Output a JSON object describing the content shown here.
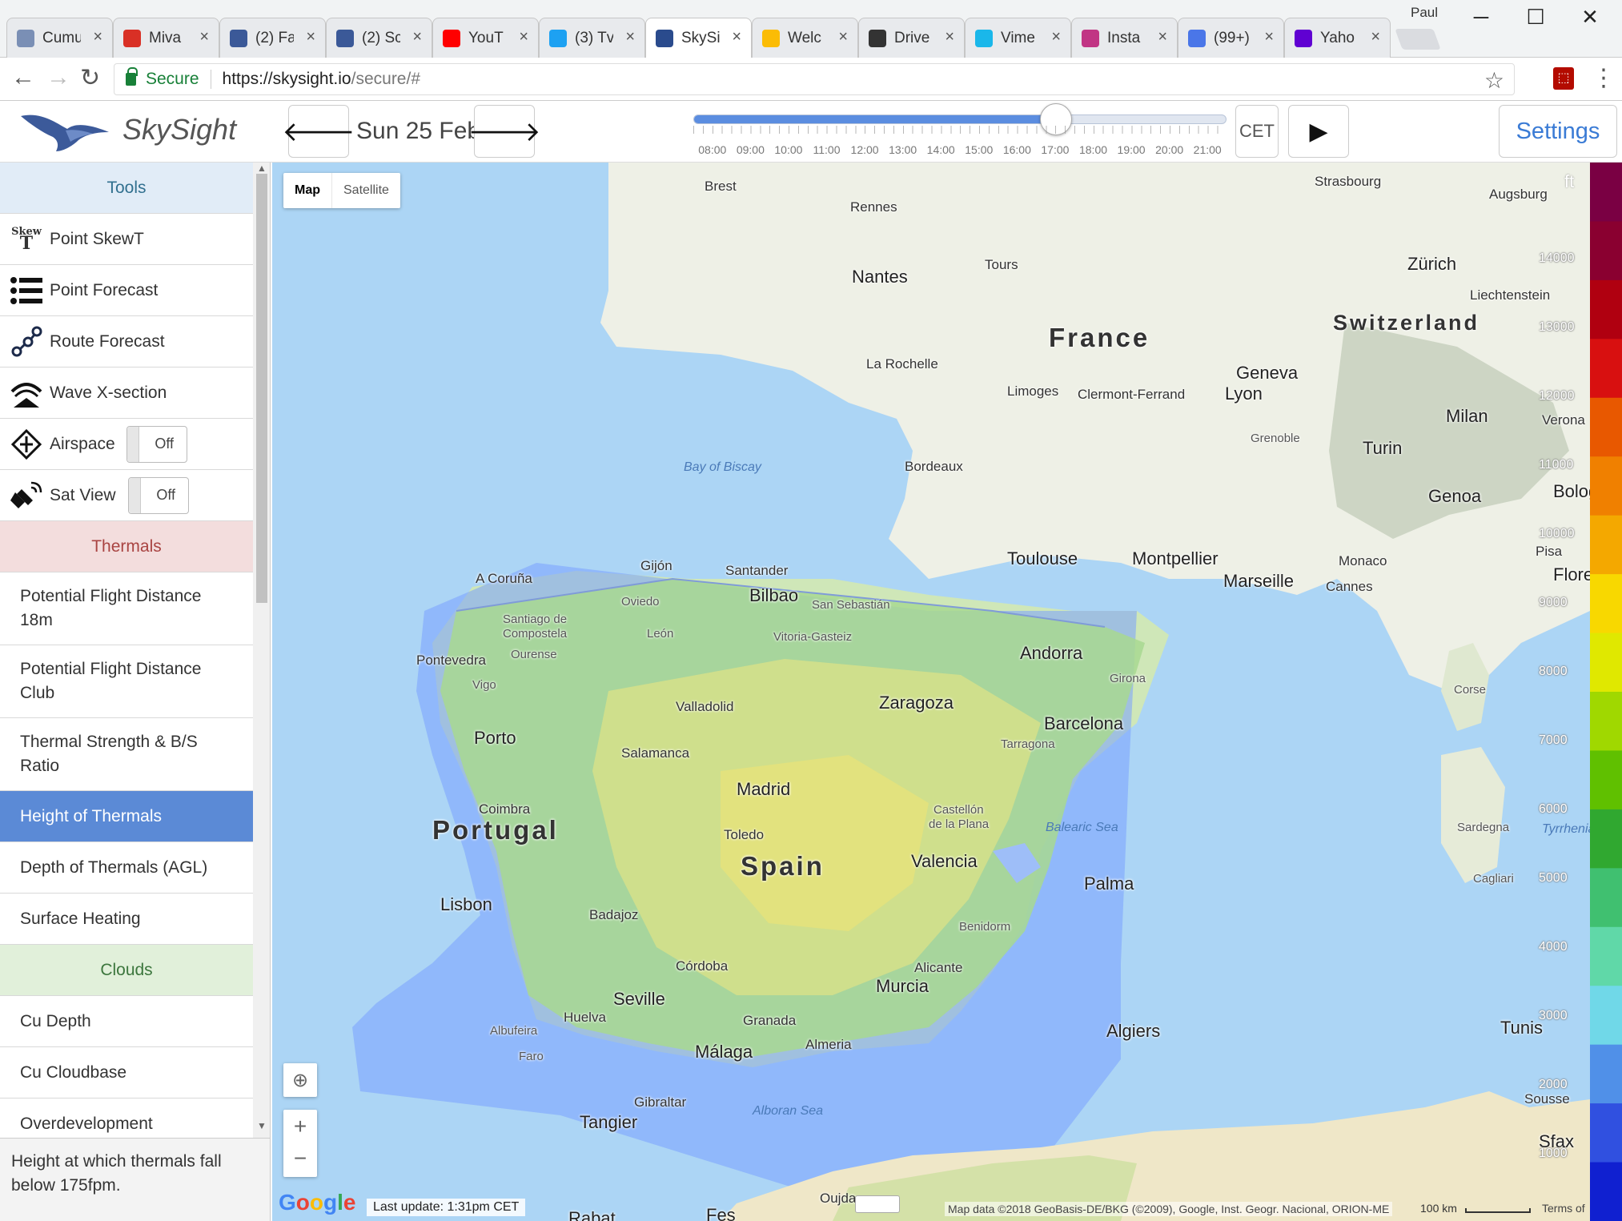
{
  "browser": {
    "tabs": [
      {
        "title": "Cumu",
        "icon": "cumulus-icon",
        "color": "#7a8fb5"
      },
      {
        "title": "Miva",
        "icon": "gmail-icon",
        "color": "#d93025"
      },
      {
        "title": "(2) Fa",
        "icon": "facebook-icon",
        "color": "#3b5998"
      },
      {
        "title": "(2) Sc",
        "icon": "facebook-icon",
        "color": "#3b5998"
      },
      {
        "title": "YouT",
        "icon": "youtube-icon",
        "color": "#ff0000"
      },
      {
        "title": "(3) Tv",
        "icon": "twitter-icon",
        "color": "#1da1f2"
      },
      {
        "title": "SkySi",
        "icon": "skysight-icon",
        "color": "#2a4b8d",
        "active": true
      },
      {
        "title": "Welc",
        "icon": "photos-icon",
        "color": "#fbbc05"
      },
      {
        "title": "Drive",
        "icon": "drive-icon",
        "color": "#333333"
      },
      {
        "title": "Vime",
        "icon": "vimeo-icon",
        "color": "#1ab7ea"
      },
      {
        "title": "Insta",
        "icon": "instagram-icon",
        "color": "#c13584"
      },
      {
        "title": "(99+)",
        "icon": "messages-icon",
        "color": "#4a76e8"
      },
      {
        "title": "Yaho",
        "icon": "yahoo-icon",
        "color": "#6001d2"
      }
    ],
    "profile": "Paul",
    "secure_label": "Secure",
    "url_host": "https://skysight.io",
    "url_path": "/secure/#"
  },
  "header": {
    "app_title": "SkySight",
    "date": "Sun 25 Feb",
    "timezone": "CET",
    "settings_label": "Settings",
    "times": [
      "08:00",
      "09:00",
      "10:00",
      "11:00",
      "12:00",
      "13:00",
      "14:00",
      "15:00",
      "16:00",
      "17:00",
      "18:00",
      "19:00",
      "20:00",
      "21:00"
    ],
    "selected_time": "17:00"
  },
  "sidebar": {
    "tools_header": "Tools",
    "tools": [
      {
        "label": "Point SkewT",
        "icon": "skewt-icon"
      },
      {
        "label": "Point Forecast",
        "icon": "list-icon"
      },
      {
        "label": "Route Forecast",
        "icon": "route-icon"
      },
      {
        "label": "Wave X-section",
        "icon": "wave-icon"
      },
      {
        "label": "Airspace",
        "icon": "airspace-icon",
        "toggle": "Off"
      },
      {
        "label": "Sat View",
        "icon": "satellite-icon",
        "toggle": "Off"
      }
    ],
    "thermals_header": "Thermals",
    "thermals": [
      {
        "label": "Potential Flight Distance 18m",
        "tall": true
      },
      {
        "label": "Potential Flight Distance Club",
        "tall": true
      },
      {
        "label": "Thermal Strength & B/S Ratio",
        "tall": true
      },
      {
        "label": "Height of Thermals",
        "active": true
      },
      {
        "label": "Depth of Thermals (AGL)"
      },
      {
        "label": "Surface Heating"
      }
    ],
    "clouds_header": "Clouds",
    "clouds": [
      {
        "label": "Cu Depth"
      },
      {
        "label": "Cu Cloudbase"
      },
      {
        "label": "Overdevelopment"
      }
    ],
    "description": "Height at which thermals fall below 175fpm."
  },
  "map": {
    "map_button": "Map",
    "satellite_button": "Satellite",
    "google": "Google",
    "last_update": "Last update: 1:31pm CET",
    "attribution": "Map data ©2018 GeoBasis-DE/BKG (©2009), Google, Inst. Geogr. Nacional, ORION-ME",
    "scale": "100 km",
    "terms": "Terms of",
    "countries": [
      "France",
      "Spain",
      "Portugal",
      "Switzerland"
    ],
    "seas": [
      "Bay of Biscay",
      "Balearic Sea",
      "Alboran Sea",
      "Tyrrhenian"
    ],
    "cities": [
      "Brest",
      "Rennes",
      "Nantes",
      "Tours",
      "La Rochelle",
      "Limoges",
      "Clermont-Ferrand",
      "Lyon",
      "Geneva",
      "Strasbourg",
      "Augsburg",
      "Zürich",
      "Liechtenstein",
      "Milan",
      "Verona",
      "Turin",
      "Grenoble",
      "Genoa",
      "Bologna",
      "Pisa",
      "Florence",
      "Bordeaux",
      "Toulouse",
      "Montpellier",
      "Marseille",
      "Monaco",
      "Cannes",
      "Corse",
      "Sardegna",
      "Cagliari",
      "Gijón",
      "Santander",
      "A Coruña",
      "Bilbao",
      "San Sebastián",
      "Oviedo",
      "Santiago de Compostela",
      "León",
      "Vitoria-Gasteiz",
      "Andorra",
      "Ourense",
      "Pontevedra",
      "Vigo",
      "Girona",
      "Valladolid",
      "Zaragoza",
      "Barcelona",
      "Tarragona",
      "Porto",
      "Salamanca",
      "Madrid",
      "Castellón de la Plana",
      "Coimbra",
      "Toledo",
      "Valencia",
      "Palma",
      "Lisbon",
      "Badajoz",
      "Benidorm",
      "Alicante",
      "Córdoba",
      "Murcia",
      "Seville",
      "Huelva",
      "Albufeira",
      "Faro",
      "Granada",
      "Almeria",
      "Málaga",
      "Gibraltar",
      "Tangier",
      "Algiers",
      "Tunis",
      "Sousse",
      "Sfax",
      "Oujda",
      "Fes",
      "Rabat"
    ]
  },
  "legend": {
    "unit": "ft",
    "labels": [
      "14000",
      "13000",
      "12000",
      "11000",
      "10000",
      "9000",
      "8000",
      "7000",
      "6000",
      "5000",
      "4000",
      "3000",
      "2000",
      "1000"
    ],
    "colors": [
      "#7a0043",
      "#8a0030",
      "#b00010",
      "#d81010",
      "#e85800",
      "#f08000",
      "#f4a800",
      "#f8d800",
      "#e0e800",
      "#a0d800",
      "#60c000",
      "#30a830",
      "#40c070",
      "#60d8a8",
      "#70d8e8",
      "#5090e8",
      "#3050e0",
      "#1020d0"
    ]
  }
}
